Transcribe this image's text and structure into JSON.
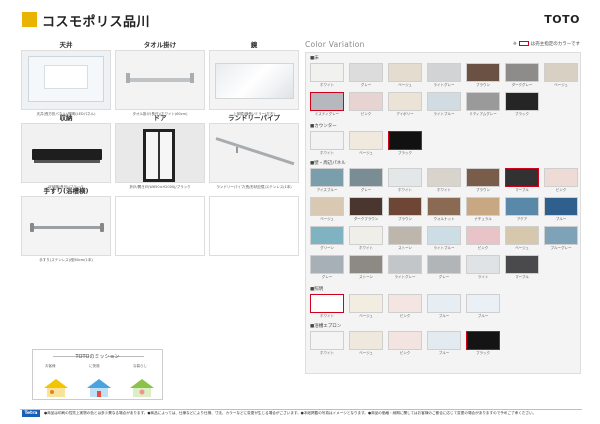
{
  "header": {
    "title": "コスモポリス品川",
    "logo": "TOTO"
  },
  "equipment": {
    "ceiling": {
      "heading": "天井",
      "caption": "天井(長方形パネル)/照明(LEDパネル)"
    },
    "towel_bar": {
      "heading": "タオル掛け",
      "caption": "タオル掛け(長尺)/ホワイト(60cm)"
    },
    "mirror": {
      "heading": "鏡",
      "caption": "上部鏡(横長)/ミラー(左右)"
    },
    "storage": {
      "heading": "収納",
      "caption": "収納棚(長尺)/ブラック"
    },
    "door": {
      "heading": "ドア",
      "caption": "折戸/開き戸(W650×H2000)/ブラック"
    },
    "laundry_pipe": {
      "heading": "ランドリーパイプ",
      "caption": "ランドリーパイプ(長/形状記憶)ステンレス(1本)"
    },
    "handrail": {
      "heading": "手すり(浴槽横)",
      "caption": "手すり(ステンレス)I型60cm(1本)"
    }
  },
  "mission": {
    "title": "TOTOのミッション",
    "texts": [
      "お客様",
      "に快適",
      "な暮らし"
    ]
  },
  "color_variation": {
    "title": "Color Variation",
    "legend_prefix": "※",
    "legend_suffix": "は売主指定のカラーです",
    "sections": {
      "floor": "■床",
      "counter": "■カウンター",
      "wall_panel": "■壁・周辺パネル",
      "lighting": "■照明",
      "apron": "■浴槽エプロン"
    },
    "floor": [
      {
        "name": "ホワイト",
        "color": "#f1f1ef"
      },
      {
        "name": "グレー",
        "color": "#dcdcdc"
      },
      {
        "name": "ベージュ",
        "color": "#e4dccf"
      },
      {
        "name": "ライトグレー",
        "color": "#d2d3d5"
      },
      {
        "name": "ブラウン",
        "color": "#6b5144"
      },
      {
        "name": "ダークグレー",
        "color": "#8d8c8a"
      },
      {
        "name": "ベージュ",
        "color": "#d8d0c2"
      },
      {
        "name": "ミスティグレー",
        "color": "#b5b8bc",
        "std": true
      },
      {
        "name": "ピンク",
        "color": "#e7d4d2"
      },
      {
        "name": "アイボリー",
        "color": "#eae3d6"
      },
      {
        "name": "ライトブルー",
        "color": "#d0dbe2"
      },
      {
        "name": "ミディアムグレー",
        "color": "#9a9a9a"
      },
      {
        "name": "ブラック",
        "color": "#252526"
      }
    ],
    "counter": [
      {
        "name": "ホワイト",
        "color": "#f2f2f2"
      },
      {
        "name": "ベージュ",
        "color": "#efe9de"
      },
      {
        "name": "ブラック",
        "color": "#111111",
        "std": true
      }
    ],
    "walls": [
      {
        "name": "アイスブルー",
        "color": "#7a9eab"
      },
      {
        "name": "グレー",
        "color": "#7a8c94"
      },
      {
        "name": "ホワイト",
        "color": "#e4e7e8"
      },
      {
        "name": "ホワイト",
        "color": "#d8d4cc"
      },
      {
        "name": "ブラウン",
        "color": "#7a5c4a"
      },
      {
        "name": "マーブル",
        "color": "#323232",
        "std": true
      },
      {
        "name": "ピンク",
        "color": "#eedbd6"
      },
      {
        "name": "ベージュ",
        "color": "#d9c8b2"
      },
      {
        "name": "ダークブラウン",
        "color": "#4a362e"
      },
      {
        "name": "ブラウン",
        "color": "#6e4636"
      },
      {
        "name": "ウォルナット",
        "color": "#8a6a52"
      },
      {
        "name": "ナチュラル",
        "color": "#c7a882"
      },
      {
        "name": "アクア",
        "color": "#5a88a8"
      },
      {
        "name": "ブルー",
        "color": "#2f5f8c"
      },
      {
        "name": "グリーン",
        "color": "#7fb3c2"
      },
      {
        "name": "ホワイト",
        "color": "#f0eee8"
      },
      {
        "name": "ストーン",
        "color": "#bdb6ac"
      },
      {
        "name": "ライトブルー",
        "color": "#cddde6"
      },
      {
        "name": "ピンク",
        "color": "#e8c4c8"
      },
      {
        "name": "ベージュ",
        "color": "#d6c7ad"
      },
      {
        "name": "ブルーグレー",
        "color": "#7ea2b8"
      },
      {
        "name": "グレー",
        "color": "#a7b0b6"
      },
      {
        "name": "ストーン",
        "color": "#8d8a86"
      },
      {
        "name": "ライトグレー",
        "color": "#c2c6c8"
      },
      {
        "name": "グレー",
        "color": "#b1b5b7"
      },
      {
        "name": "ライト",
        "color": "#dfe3e5"
      },
      {
        "name": "マーブル",
        "color": "#4a4a4c"
      }
    ],
    "lighting": [
      {
        "name": "ホワイト",
        "color": "#ffffff",
        "std": true
      },
      {
        "name": "ベージュ",
        "color": "#f3ece0"
      },
      {
        "name": "ピンク",
        "color": "#f4e4e2"
      },
      {
        "name": "ブルー",
        "color": "#e6eef3"
      },
      {
        "name": "ブルー",
        "color": "#eaf0f5"
      }
    ],
    "apron": [
      {
        "name": "ホワイト",
        "color": "#f4f4f4"
      },
      {
        "name": "ベージュ",
        "color": "#efe9dd"
      },
      {
        "name": "ピンク",
        "color": "#f3e3e1"
      },
      {
        "name": "ブルー",
        "color": "#e3ebf0"
      },
      {
        "name": "ブラック",
        "color": "#141414",
        "std": true
      }
    ]
  },
  "footer": {
    "badge": "Tetra",
    "note": "●商品は印刷の性質上実物の色とは多少異なる場合があります。●商品によっては、仕様などにより仕様、寸法、カラーなどに変更が生じる場合がございます。●本紙掲載の写真はイメージとなります。●商品の価格・納期に関してはお客様のご都合に応じて変更の場合がありますので予めご了承ください。"
  }
}
